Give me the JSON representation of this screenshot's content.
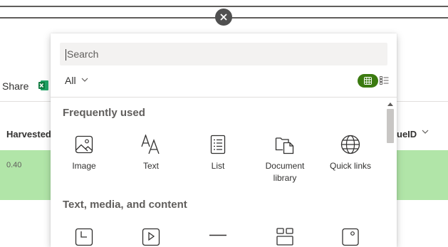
{
  "background": {
    "share_label": "Share",
    "columns": [
      "Harvested",
      "ueID"
    ],
    "row_value": "0.40",
    "row_color": "#b1e5a8"
  },
  "close_icon": "close-icon",
  "picker": {
    "search_placeholder": "Search",
    "filter_label": "All",
    "active_view_color": "#3b7a10",
    "sections": [
      {
        "title": "Frequently used",
        "items": [
          {
            "label": "Image",
            "icon": "image-icon"
          },
          {
            "label": "Text",
            "icon": "text-icon"
          },
          {
            "label": "List",
            "icon": "list-icon"
          },
          {
            "label": "Document library",
            "icon": "document-library-icon"
          },
          {
            "label": "Quick links",
            "icon": "quick-links-icon"
          }
        ]
      },
      {
        "title": "Text, media, and content",
        "items": [
          {
            "icon": "chart-icon"
          },
          {
            "icon": "video-icon"
          },
          {
            "icon": "divider-icon"
          },
          {
            "icon": "web-part-icon"
          },
          {
            "icon": "image-gallery-icon"
          }
        ]
      }
    ]
  }
}
